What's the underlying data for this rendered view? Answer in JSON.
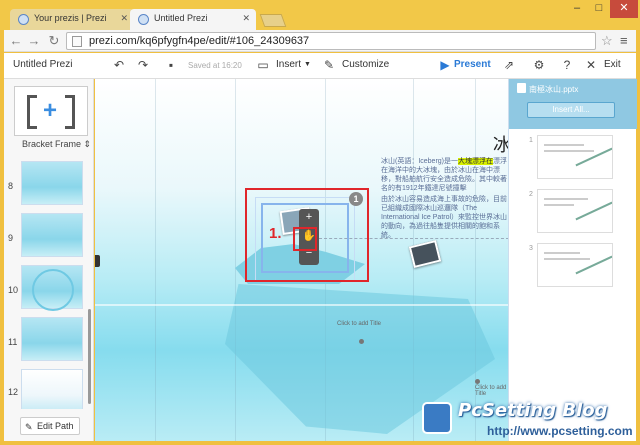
{
  "browser": {
    "tabs": [
      {
        "label": "Your prezis | Prezi"
      },
      {
        "label": "Untitled Prezi"
      }
    ],
    "url": "prezi.com/kq6pfygfn4pe/edit/#106_24309637"
  },
  "toolbar": {
    "title": "Untitled Prezi",
    "saved": "Saved at 16:20",
    "insert_label": "Insert",
    "customize_label": "Customize",
    "present_label": "Present",
    "exit_label": "Exit"
  },
  "left_panel": {
    "frame_label": "Bracket Frame",
    "slide_numbers": [
      "8",
      "9",
      "10",
      "11",
      "12"
    ],
    "edit_path_label": "Edit Path"
  },
  "canvas": {
    "title": "冰",
    "para1_pre": "冰山(英語：Iceberg)是一",
    "para1_hl": "大塊漂浮在",
    "para1_post": "漂浮在海洋中的大冰塊，由於冰山在海中漂移，對船舶航行安全造成危險。其中較著名的有1912年鐵達尼號撞擊",
    "para2": "由於冰山容易造成海上事故的危險，目前已組織成國際冰山巡邏隊（The International Ice Patrol）來監控世界冰山的動向，為過往船隻提供相關的飽和系統。",
    "frame_badge": "1",
    "annotation": "1.",
    "label_a": "Click to add Title",
    "label_b": "Click to add Title"
  },
  "right_panel": {
    "title": "南極冰山.pptx",
    "insert_all_label": "Insert All...",
    "slide_numbers": [
      "1",
      "2",
      "3"
    ]
  },
  "watermark": {
    "brand": "PcSetting Blog",
    "url": "http://www.pcsetting.com"
  }
}
